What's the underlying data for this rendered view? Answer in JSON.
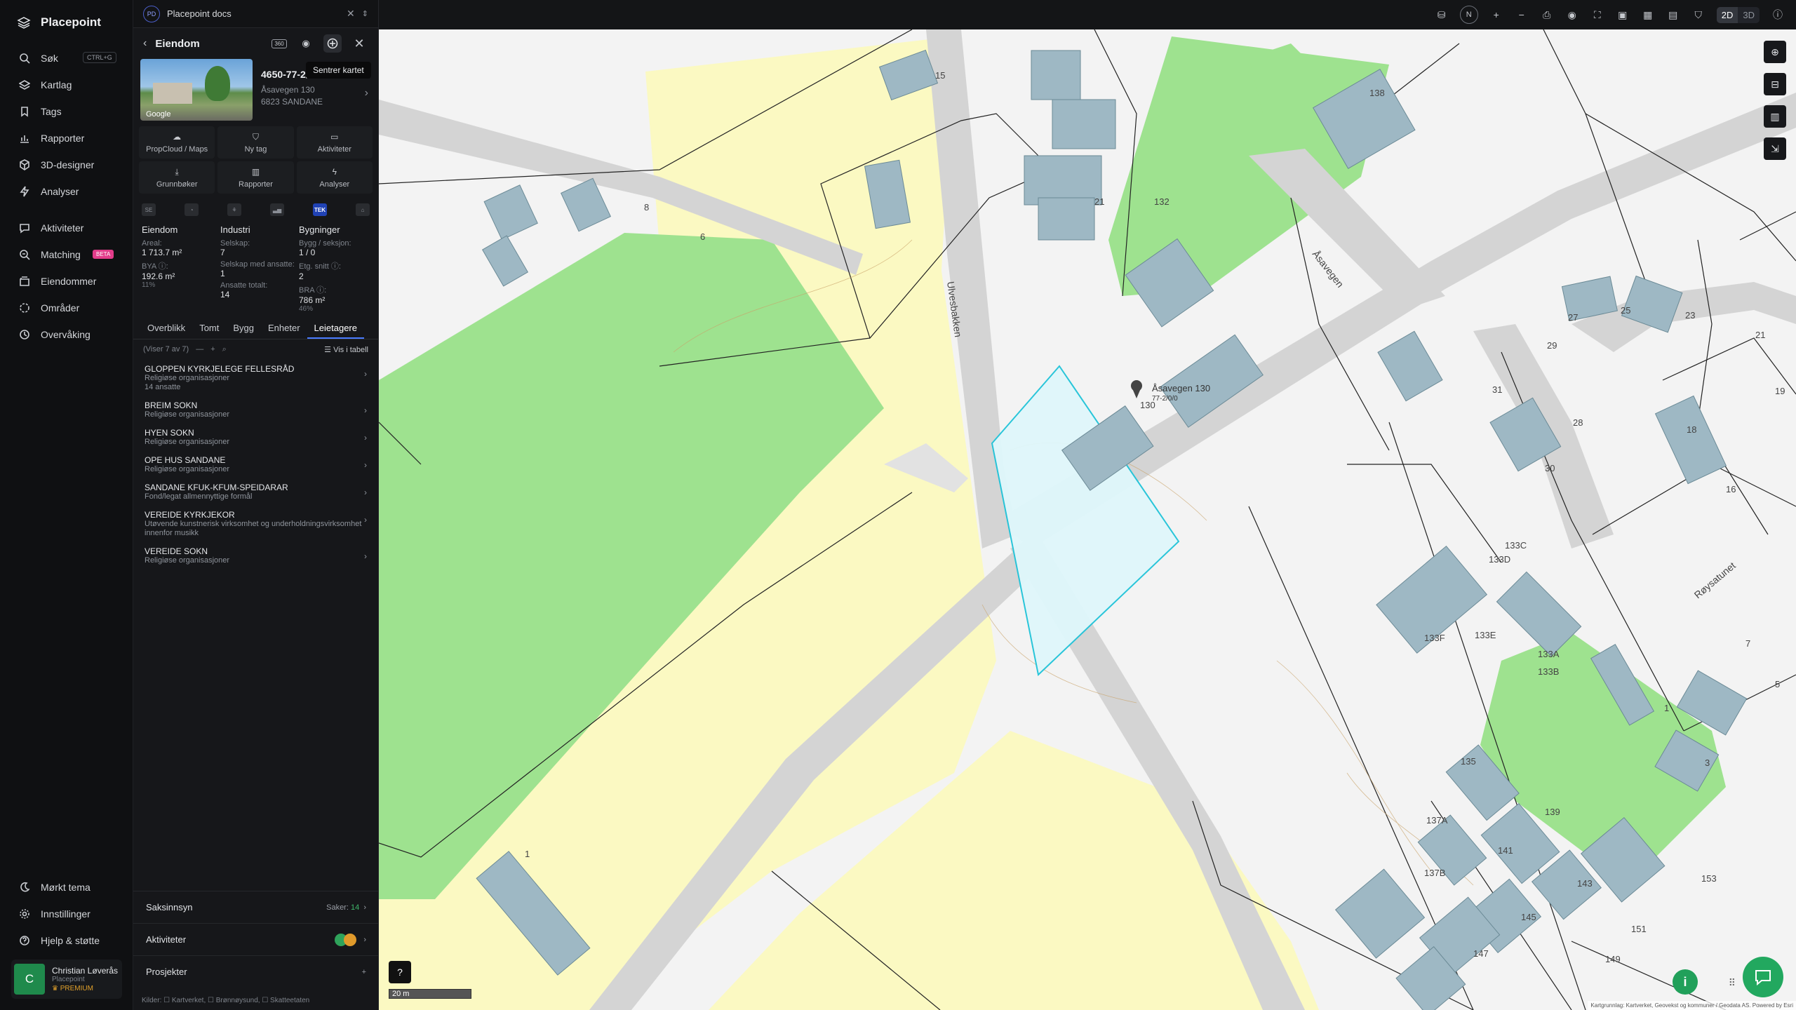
{
  "app": {
    "name": "Placepoint"
  },
  "nav": {
    "items": [
      {
        "label": "Søk",
        "icon": "search-icon",
        "shortcut": "CTRL+G"
      },
      {
        "label": "Kartlag",
        "icon": "layers-icon"
      },
      {
        "label": "Tags",
        "icon": "bookmark-icon"
      },
      {
        "label": "Rapporter",
        "icon": "chart-icon"
      },
      {
        "label": "3D-designer",
        "icon": "cube-icon"
      },
      {
        "label": "Analyser",
        "icon": "bolt-icon"
      },
      {
        "label": "Aktiviteter",
        "icon": "chat-icon"
      },
      {
        "label": "Matching",
        "icon": "matching-icon",
        "badge": "BETA"
      },
      {
        "label": "Eiendommer",
        "icon": "stack-icon"
      },
      {
        "label": "Områder",
        "icon": "area-icon"
      },
      {
        "label": "Overvåking",
        "icon": "monitor-icon"
      }
    ],
    "bottom": [
      {
        "label": "Mørkt tema",
        "icon": "moon-icon"
      },
      {
        "label": "Innstillinger",
        "icon": "gear-icon"
      },
      {
        "label": "Hjelp & støtte",
        "icon": "help-icon"
      }
    ],
    "user": {
      "initial": "C",
      "name": "Christian Løverås",
      "org": "Placepoint",
      "plan": "PREMIUM"
    }
  },
  "panel": {
    "tab": {
      "badge": "PD",
      "title": "Placepoint docs"
    },
    "header": {
      "title": "Eiendom",
      "badge360": "360",
      "tooltip": "Sentrer kartet"
    },
    "property": {
      "id": "4650-77-2/0/0",
      "address": "Åsavegen 130",
      "postal": "6823 SANDANE",
      "photo_credit": "Google"
    },
    "actions": [
      {
        "label": "PropCloud / Maps",
        "icon": "cloud-icon"
      },
      {
        "label": "Ny tag",
        "icon": "tag-icon"
      },
      {
        "label": "Aktiviteter",
        "icon": "chat-icon"
      },
      {
        "label": "Grunnbøker",
        "icon": "download-icon"
      },
      {
        "label": "Rapporter",
        "icon": "chart-icon"
      },
      {
        "label": "Analyser",
        "icon": "bolt-icon"
      }
    ],
    "sources": [
      "SE",
      "◔",
      "⚘",
      "▃▅",
      "TEK",
      "⌂"
    ],
    "stats": {
      "col1": {
        "title": "Eiendom",
        "areal_label": "Areal:",
        "areal": "1 713.7 m²",
        "bya_label": "BYA ⓘ:",
        "bya": "192.6 m²",
        "bya_pct": "11%"
      },
      "col2": {
        "title": "Industri",
        "selskap_label": "Selskap:",
        "selskap": "7",
        "ansatte_label": "Selskap med ansatte:",
        "ansatte": "1",
        "totalt_label": "Ansatte totalt:",
        "totalt": "14"
      },
      "col3": {
        "title": "Bygninger",
        "bygg_label": "Bygg / seksjon:",
        "bygg": "1 / 0",
        "etg_label": "Etg. snitt ⓘ:",
        "etg": "2",
        "bra_label": "BRA ⓘ:",
        "bra": "786 m²",
        "bra_pct": "46%"
      }
    },
    "tabs": [
      "Overblikk",
      "Tomt",
      "Bygg",
      "Enheter",
      "Leietagere"
    ],
    "selected_tab": "Leietagere",
    "list_meta": {
      "count": "(Viser 7 av 7)",
      "table": "Vis i tabell"
    },
    "tenants": [
      {
        "name": "GLOPPEN KYRKJELEGE FELLESRÅD",
        "sub": "Religiøse organisasjoner",
        "extra": "14 ansatte"
      },
      {
        "name": "BREIM SOKN",
        "sub": "Religiøse organisasjoner"
      },
      {
        "name": "HYEN SOKN",
        "sub": "Religiøse organisasjoner"
      },
      {
        "name": "OPE HUS SANDANE",
        "sub": "Religiøse organisasjoner"
      },
      {
        "name": "SANDANE KFUK-KFUM-SPEIDARAR",
        "sub": "Fond/legat allmennyttige formål"
      },
      {
        "name": "VEREIDE KYRKJEKOR",
        "sub": "Utøvende kunstnerisk virksomhet og underholdningsvirksomhet innenfor musikk"
      },
      {
        "name": "VEREIDE SOKN",
        "sub": "Religiøse organisasjoner"
      }
    ],
    "sections": {
      "saksinnsyn": {
        "label": "Saksinnsyn",
        "count_label": "Saker:",
        "count": "14"
      },
      "aktiviteter": {
        "label": "Aktiviteter"
      },
      "prosjekter": {
        "label": "Prosjekter"
      }
    },
    "kilder": "Kilder: ☐ Kartverket, ☐ Brønnøysund, ☐ Skatteetaten"
  },
  "map": {
    "toolbar": {
      "compass": "N",
      "mode2d": "2D",
      "mode3d": "3D",
      "active": "2D"
    },
    "road_labels": [
      "Åsavegen",
      "Ulvesbakken",
      "Røysatunet"
    ],
    "marker": {
      "label": "Åsavegen 130",
      "sub": "77-2/0/0"
    },
    "building_labels": [
      "15",
      "8",
      "6",
      "21",
      "132",
      "138",
      "130",
      "27",
      "25",
      "23",
      "21",
      "29",
      "31",
      "28",
      "30",
      "18",
      "16",
      "19",
      "133C",
      "133D",
      "133E",
      "133F",
      "133A",
      "133B",
      "7",
      "5",
      "1",
      "3",
      "135",
      "137A",
      "139",
      "137B",
      "141",
      "143",
      "145",
      "147",
      "153",
      "151",
      "149",
      "1"
    ],
    "scale": "20 m",
    "attribution": "Kartgrunnlag: Kartverket, Geovekst og kommuner / Geodata AS. Powered by Esri"
  }
}
